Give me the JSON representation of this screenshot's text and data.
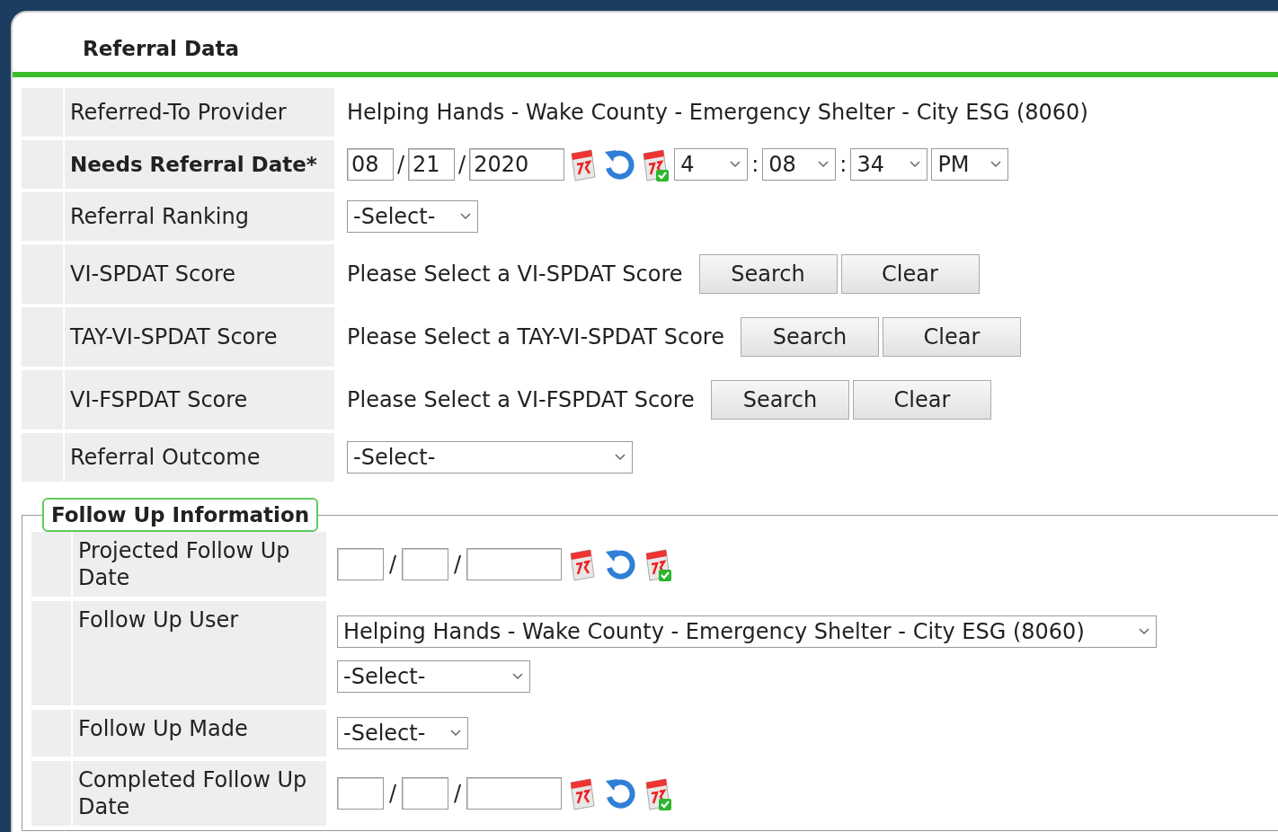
{
  "panel": {
    "title": "Referral Data"
  },
  "rows": [
    {
      "kind": "text",
      "label": "Referred-To Provider",
      "required": false,
      "value": "Helping Hands - Wake County - Emergency Shelter - City ESG (8060)"
    },
    {
      "kind": "datetime",
      "label": "Needs Referral Date",
      "required": true,
      "required_mark": "*",
      "month": "08",
      "day": "21",
      "year": "2020",
      "separators": [
        "/",
        "/"
      ],
      "hour": "4",
      "minute": "08",
      "second": "34",
      "time_separators": [
        ":",
        ":"
      ],
      "ampm": "PM"
    },
    {
      "kind": "select",
      "label": "Referral Ranking",
      "required": false,
      "value": "-Select-"
    },
    {
      "kind": "score",
      "label": "VI-SPDAT Score",
      "required": false,
      "prompt": "Please Select a VI-SPDAT Score",
      "buttons": [
        "Search",
        "Clear"
      ]
    },
    {
      "kind": "score",
      "label": "TAY-VI-SPDAT Score",
      "required": false,
      "prompt": "Please Select a TAY-VI-SPDAT Score",
      "buttons": [
        "Search",
        "Clear"
      ]
    },
    {
      "kind": "score",
      "label": "VI-FSPDAT Score",
      "required": false,
      "prompt": "Please Select a VI-FSPDAT Score",
      "buttons": [
        "Search",
        "Clear"
      ]
    },
    {
      "kind": "wideselect",
      "label": "Referral Outcome",
      "required": false,
      "value": "-Select-"
    }
  ],
  "follow_up": {
    "legend": "Follow Up Information",
    "rows": [
      {
        "kind": "date",
        "label": "Projected Follow Up Date",
        "separators": [
          "/",
          "/"
        ]
      },
      {
        "kind": "selects",
        "label": "Follow Up User",
        "values": [
          "Helping Hands - Wake County - Emergency Shelter - City ESG (8060)",
          "-Select-"
        ]
      },
      {
        "kind": "select",
        "label": "Follow Up Made",
        "value": "-Select-"
      },
      {
        "kind": "date",
        "label": "Completed Follow Up Date",
        "separators": [
          "/",
          "/"
        ]
      }
    ]
  }
}
